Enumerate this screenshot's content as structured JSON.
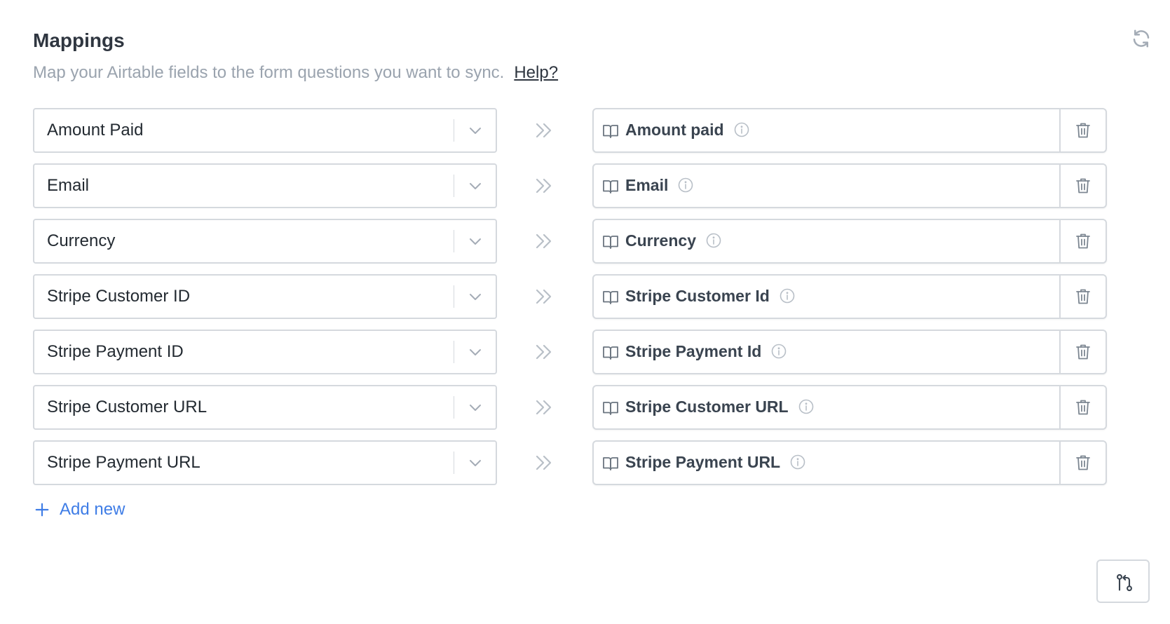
{
  "header": {
    "title": "Mappings",
    "subtitle": "Map your Airtable fields to the form questions you want to sync.",
    "help_link": "Help?",
    "refresh_icon": "refresh-icon"
  },
  "mappings": [
    {
      "source": "Amount Paid",
      "target": "Amount paid"
    },
    {
      "source": "Email",
      "target": "Email"
    },
    {
      "source": "Currency",
      "target": "Currency"
    },
    {
      "source": "Stripe Customer ID",
      "target": "Stripe Customer Id"
    },
    {
      "source": "Stripe Payment ID",
      "target": "Stripe Payment Id"
    },
    {
      "source": "Stripe Customer URL",
      "target": "Stripe Customer URL"
    },
    {
      "source": "Stripe Payment URL",
      "target": "Stripe Payment URL"
    }
  ],
  "actions": {
    "add_new_label": "Add new"
  },
  "icons": {
    "chevron": "chevron-down-icon",
    "arrow": "double-chevron-right-icon",
    "question": "book-icon",
    "info": "info-icon",
    "delete": "trash-icon",
    "corner": "git-pull-request-icon"
  },
  "colors": {
    "accent": "#3f7de6",
    "border": "#d5d9de",
    "muted_text": "#9aa3ae",
    "icon": "#a4acb6"
  }
}
